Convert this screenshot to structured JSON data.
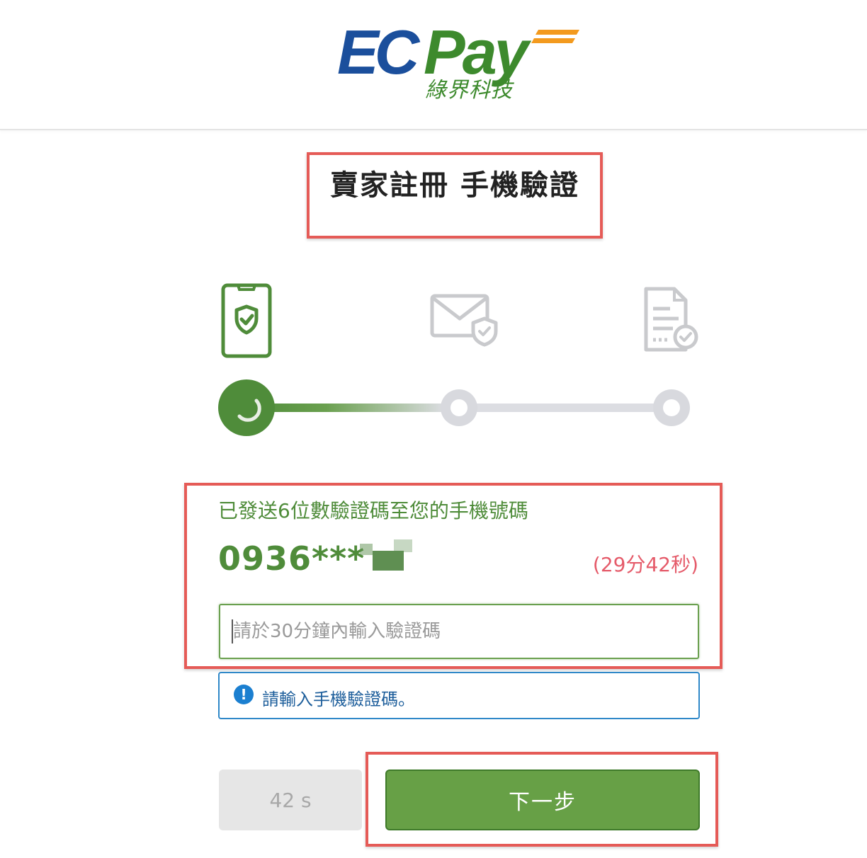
{
  "header": {
    "logo": {
      "ec": "EC",
      "pay": "Pay",
      "subtitle": "綠界科技"
    }
  },
  "page": {
    "title": "賣家註冊 手機驗證"
  },
  "steps": {
    "icons": [
      "phone-shield-icon",
      "mail-shield-icon",
      "document-check-icon"
    ],
    "current_step": 1,
    "total_steps": 3
  },
  "verification": {
    "sent_message": "已發送6位數驗證碼至您的手機號碼",
    "phone_masked": "0936***",
    "countdown": "(29分42秒)",
    "code_input": {
      "value": "",
      "placeholder": "請於30分鐘內輸入驗證碼"
    },
    "hint": "請輸入手機驗證碼。"
  },
  "actions": {
    "resend_timer_label": "42 s",
    "next_label": "下一步"
  },
  "colors": {
    "brand_blue": "#1b4f9c",
    "brand_green": "#3d8a2d",
    "brand_orange": "#f39a1e",
    "accent_green": "#67a046",
    "countdown_red": "#e55b6a",
    "hint_blue": "#2f88c8",
    "highlight_red": "#e55b57"
  }
}
